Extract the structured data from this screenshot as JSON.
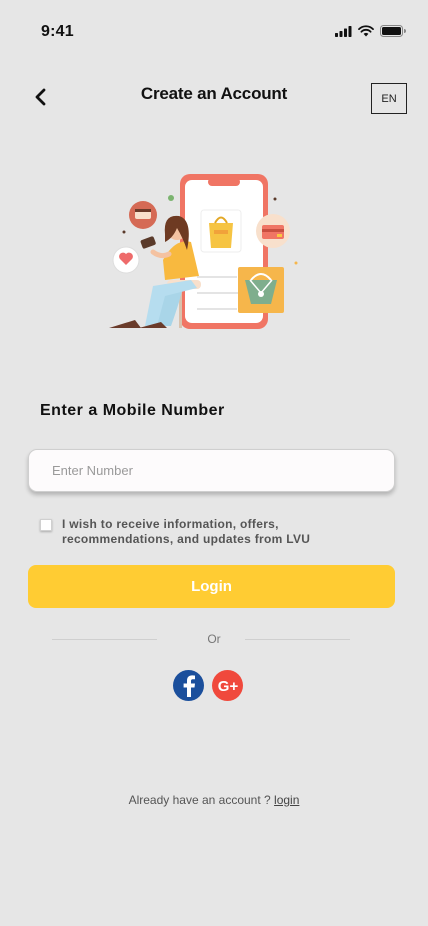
{
  "status_bar": {
    "time": "9:41"
  },
  "header": {
    "title": "Create an Account",
    "language": "EN"
  },
  "form": {
    "section_title": "Enter a Mobile Number",
    "phone_placeholder": "Enter Number",
    "phone_value": "",
    "consent_text": "I wish to receive information, offers, recommendations, and updates from LVU",
    "consent_checked": false,
    "login_label": "Login"
  },
  "divider": {
    "label": "Or"
  },
  "social": {
    "icons": [
      "facebook-icon",
      "google-plus-icon"
    ],
    "google_label": "G+"
  },
  "footer": {
    "prompt": "Already have an account ?",
    "link": "login"
  },
  "colors": {
    "background": "#e6e6e6",
    "accent": "#ffcc33",
    "facebook": "#1b4f9c",
    "google": "#f0493c"
  }
}
